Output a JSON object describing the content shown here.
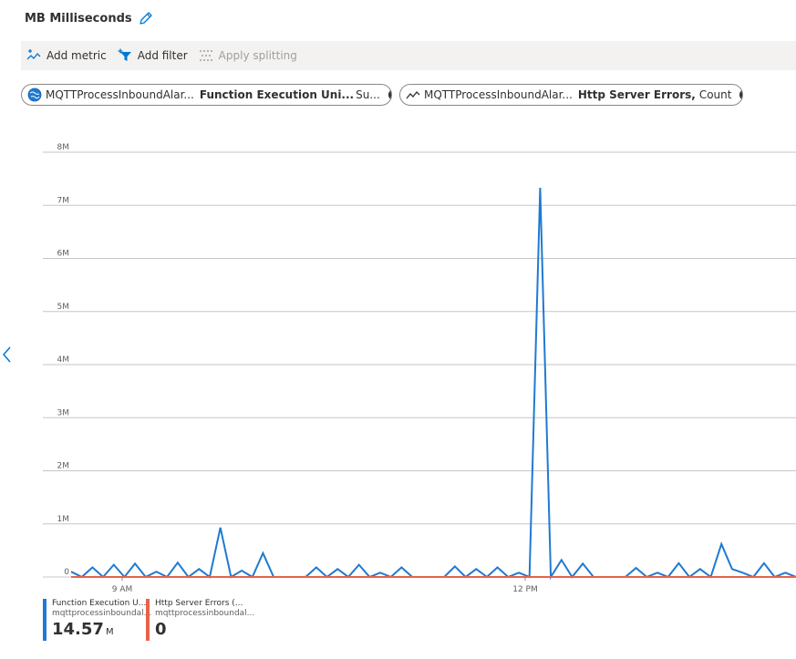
{
  "header": {
    "title": "MB Milliseconds",
    "edit_icon": "pencil-icon"
  },
  "toolbar": {
    "add_metric": "Add metric",
    "add_filter": "Add filter",
    "apply_splitting": "Apply splitting"
  },
  "pills": [
    {
      "resource": "MQTTProcessInboundAlar...",
      "metric": "Function Execution Uni...",
      "aggregation": "Su...",
      "icon": "globe-icon"
    },
    {
      "resource": "MQTTProcessInboundAlar...",
      "metric": "Http Server Errors,",
      "aggregation": "Count",
      "icon": "line-chart-icon"
    }
  ],
  "colors": {
    "series1": "#1f7ad2",
    "series2": "#e8624b",
    "grid": "#c8c6c4",
    "accent": "#0078d4"
  },
  "chart_data": {
    "type": "line",
    "y_ticks": [
      "0",
      "1M",
      "2M",
      "3M",
      "4M",
      "5M",
      "6M",
      "7M",
      "8M"
    ],
    "ylim": [
      0,
      8000000
    ],
    "x_ticks": [
      "9 AM",
      "12 PM"
    ],
    "series": [
      {
        "name": "Function Execution U...",
        "values": [
          100000,
          0,
          180000,
          0,
          230000,
          0,
          250000,
          0,
          100000,
          0,
          270000,
          0,
          150000,
          0,
          930000,
          0,
          120000,
          0,
          450000,
          0,
          0,
          0,
          0,
          180000,
          0,
          150000,
          0,
          230000,
          0,
          80000,
          0,
          180000,
          0,
          0,
          0,
          0,
          200000,
          0,
          150000,
          0,
          180000,
          0,
          80000,
          0,
          7330000,
          0,
          320000,
          0,
          250000,
          0,
          0,
          0,
          0,
          170000,
          0,
          80000,
          0,
          260000,
          0,
          150000,
          0,
          620000,
          150000,
          80000,
          0,
          260000,
          0,
          80000,
          0
        ]
      },
      {
        "name": "Http Server Errors (...",
        "values": [
          0,
          0
        ]
      }
    ]
  },
  "legend": [
    {
      "name": "Function Execution U...",
      "sub": "mqttprocessinboundal...",
      "value": "14.57",
      "unit": "M"
    },
    {
      "name": "Http Server Errors (...",
      "sub": "mqttprocessinboundal...",
      "value": "0",
      "unit": ""
    }
  ],
  "nav": {
    "collapse_icon": "chevron-left-icon"
  }
}
